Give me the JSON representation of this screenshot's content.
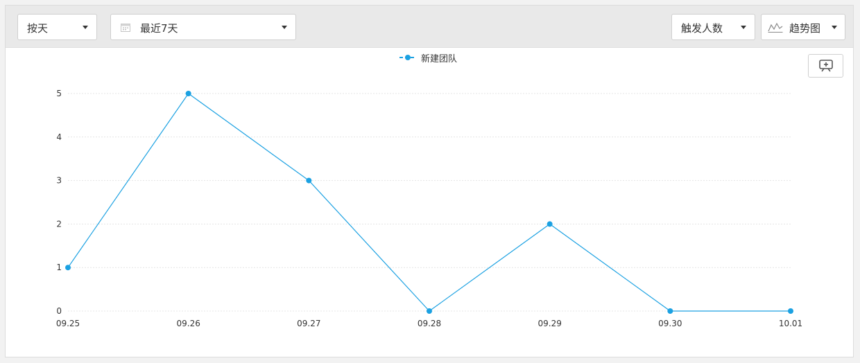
{
  "toolbar": {
    "granularity": {
      "label": "按天",
      "icon": "chevron-down"
    },
    "date_range": {
      "label": "最近7天",
      "icon": "calendar-icon"
    },
    "metric": {
      "label": "触发人数",
      "icon": "chevron-down"
    },
    "chart_type": {
      "label": "趋势图",
      "icon": "trend-line-icon"
    }
  },
  "actions": {
    "zoom_icon": "zoom-in-icon"
  },
  "colors": {
    "series": "#1ba1e2",
    "toolbar_bg": "#e9e9e9",
    "grid": "#e4e4e4"
  },
  "chart_data": {
    "type": "line",
    "x": [
      "09.25",
      "09.26",
      "09.27",
      "09.28",
      "09.29",
      "09.30",
      "10.01"
    ],
    "y_ticks": [
      0,
      1,
      2,
      3,
      4,
      5
    ],
    "ylim": [
      0,
      5
    ],
    "series": [
      {
        "name": "新建团队",
        "values": [
          1,
          5,
          3,
          0,
          2,
          0,
          0
        ]
      }
    ],
    "legend_position": "top-center",
    "grid": true
  }
}
